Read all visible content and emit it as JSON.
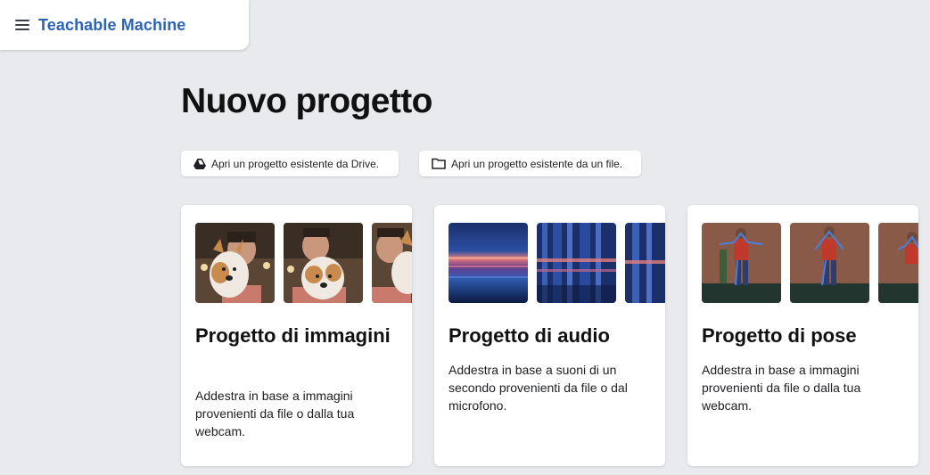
{
  "header": {
    "title": "Teachable Machine",
    "menu_icon": "menu-icon"
  },
  "page_title": "Nuovo progetto",
  "open_buttons": [
    {
      "label": "Apri un progetto esistente da Drive.",
      "icon": "drive-icon"
    },
    {
      "label": "Apri un progetto esistente da un file.",
      "icon": "folder-icon"
    }
  ],
  "projects": [
    {
      "title": "Progetto di immagini",
      "description": "Addestra in base a immagini provenienti da file o dalla tua webcam."
    },
    {
      "title": "Progetto di audio",
      "description": "Addestra in base a suoni di un secondo provenienti da file o dal microfono."
    },
    {
      "title": "Progetto di pose",
      "description": "Addestra in base a immagini provenienti da file o dalla tua webcam."
    }
  ],
  "colors": {
    "brand": "#2a63b8",
    "background": "#e8eaed"
  }
}
